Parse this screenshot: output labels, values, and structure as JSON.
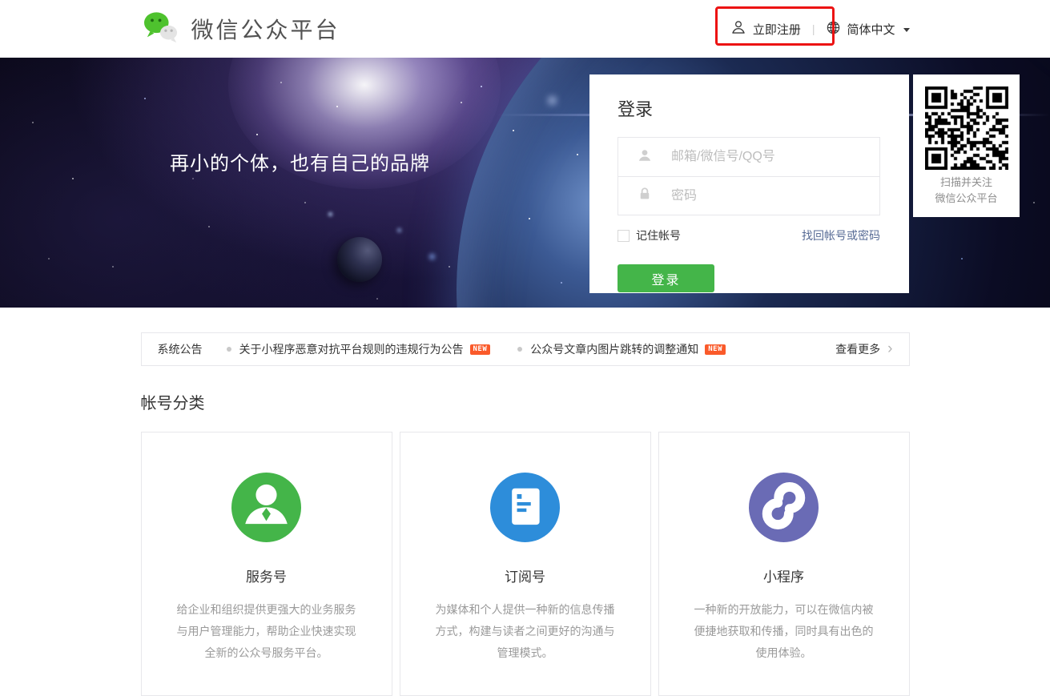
{
  "header": {
    "logo_title": "微信公众平台",
    "register_label": "立即注册",
    "divider": "|",
    "language_label": "简体中文"
  },
  "banner": {
    "tagline": "再小的个体，也有自己的品牌"
  },
  "login": {
    "title": "登录",
    "account_placeholder": "邮箱/微信号/QQ号",
    "password_placeholder": "密码",
    "remember_label": "记住帐号",
    "forgot_link": "找回帐号或密码",
    "submit_label": "登录"
  },
  "qr_panel": {
    "caption_line1": "扫描并关注",
    "caption_line2": "微信公众平台"
  },
  "announcements": {
    "label": "系统公告",
    "items": [
      {
        "title": "关于小程序恶意对抗平台规则的违规行为公告",
        "badge": "NEW"
      },
      {
        "title": "公众号文章内图片跳转的调整通知",
        "badge": "NEW"
      }
    ],
    "more_label": "查看更多",
    "more_arrow": "›"
  },
  "account_types": {
    "heading": "帐号分类",
    "cards": [
      {
        "title": "服务号",
        "icon": "service-account-icon",
        "color": "#44b549",
        "description": "给企业和组织提供更强大的业务服务与用户管理能力，帮助企业快速实现全新的公众号服务平台。"
      },
      {
        "title": "订阅号",
        "icon": "subscription-account-icon",
        "color": "#2d8dda",
        "description": "为媒体和个人提供一种新的信息传播方式，构建与读者之间更好的沟通与管理模式。"
      },
      {
        "title": "小程序",
        "icon": "miniprogram-icon",
        "color": "#6a6bb5",
        "description": "一种新的开放能力，可以在微信内被便捷地获取和传播，同时具有出色的使用体验。"
      }
    ]
  },
  "colors": {
    "accent-green": "#44b549",
    "notice-badge": "#fa5a2a",
    "link-blue": "#576b95",
    "annotation-red": "#ec1313"
  }
}
